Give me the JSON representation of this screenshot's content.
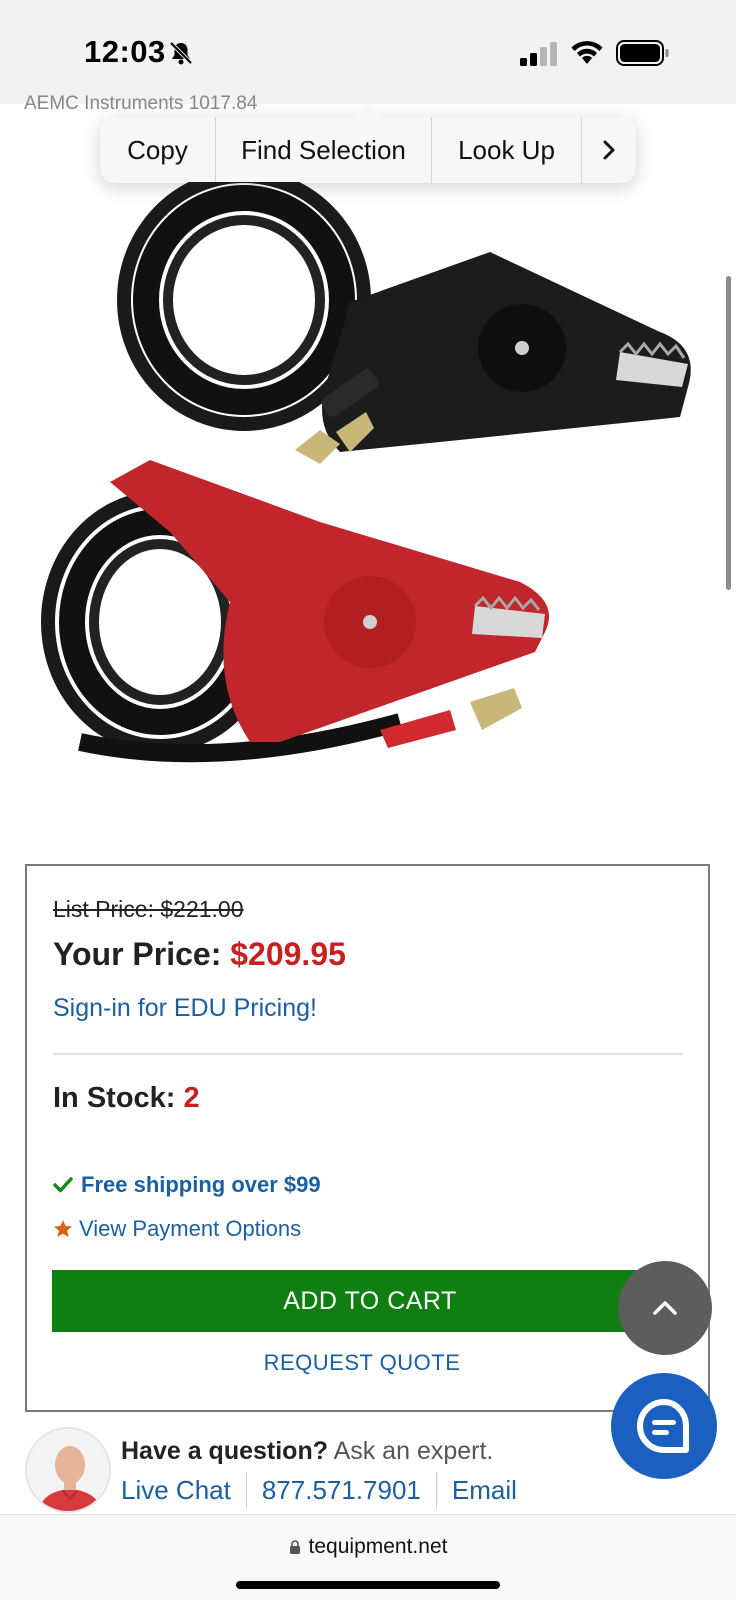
{
  "status_bar": {
    "time": "12:03",
    "icons": [
      "bell-slash-icon",
      "cellular-signal-icon",
      "wifi-icon",
      "battery-icon"
    ]
  },
  "page": {
    "breadcrumb_cut": "AEMC Instruments 1017.84"
  },
  "context_menu": {
    "copy": "Copy",
    "find_selection": "Find Selection",
    "look_up": "Look Up",
    "more_icon": "chevron-right-icon"
  },
  "product_image": {
    "description_icon": "product-photo-clamps"
  },
  "pricing": {
    "list_price": "List Price: $221.00",
    "your_price_label": "Your Price:",
    "your_price_value": "$209.95",
    "edu_link": "Sign-in for EDU Pricing!",
    "stock_label": "In Stock:",
    "stock_qty": "2",
    "free_shipping": "Free shipping over $99",
    "payment_options": "View Payment Options",
    "add_to_cart": "ADD TO CART",
    "request_quote": "REQUEST QUOTE"
  },
  "expert": {
    "question_strong": "Have a question?",
    "question_light": " Ask an expert.",
    "live_chat": "Live Chat",
    "phone": "877.571.7901",
    "email": "Email"
  },
  "url_bar": {
    "domain": "tequipment.net"
  },
  "colors": {
    "accent_blue": "#1b5fa0",
    "price_red": "#c62020",
    "cart_green": "#0f7f12",
    "fab_blue": "#1b5fc1"
  }
}
